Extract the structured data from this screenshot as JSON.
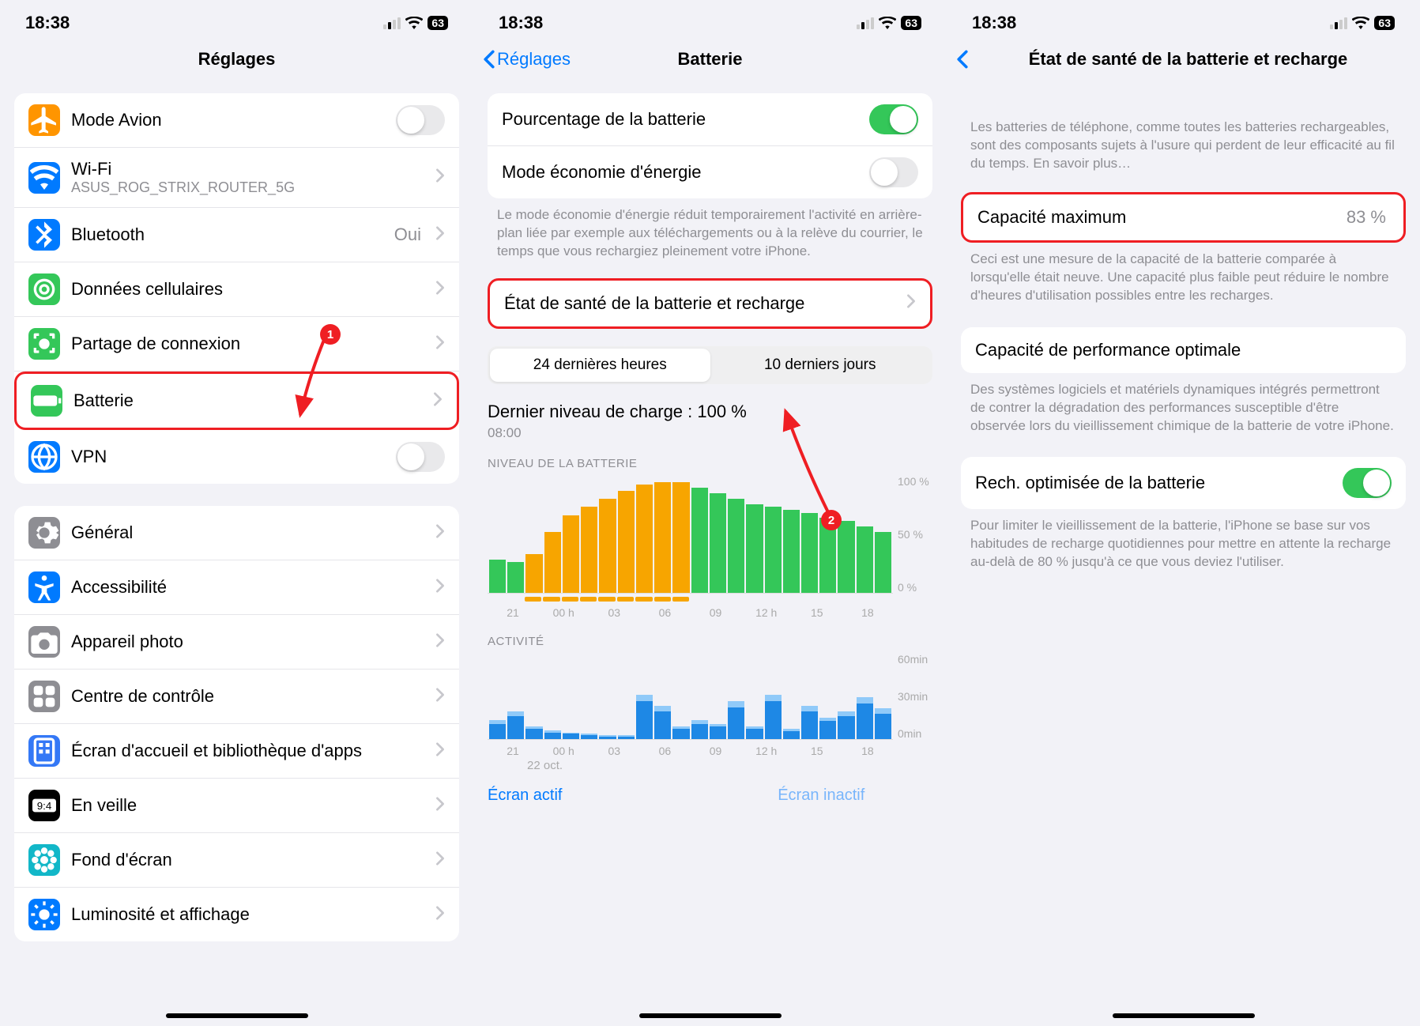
{
  "status": {
    "time": "18:38",
    "battery": "63"
  },
  "screen1": {
    "title": "Réglages",
    "group1": [
      {
        "icon": "airplane",
        "color": "#ff9500",
        "label": "Mode Avion",
        "right": "toggle-off"
      },
      {
        "icon": "wifi",
        "color": "#007aff",
        "label": "Wi-Fi",
        "sub": "ASUS_ROG_STRIX_ROUTER_5G",
        "right": "chevron"
      },
      {
        "icon": "bluetooth",
        "color": "#007aff",
        "label": "Bluetooth",
        "value": "Oui",
        "right": "chevron"
      },
      {
        "icon": "cellular",
        "color": "#34c759",
        "label": "Données cellulaires",
        "right": "chevron"
      },
      {
        "icon": "hotspot",
        "color": "#34c759",
        "label": "Partage de connexion",
        "right": "chevron"
      },
      {
        "icon": "battery",
        "color": "#34c759",
        "label": "Batterie",
        "right": "chevron",
        "highlight": true
      },
      {
        "icon": "vpn",
        "color": "#007aff",
        "label": "VPN",
        "right": "toggle-off"
      }
    ],
    "group2": [
      {
        "icon": "gear",
        "color": "#8e8e93",
        "label": "Général",
        "right": "chevron"
      },
      {
        "icon": "accessibility",
        "color": "#007aff",
        "label": "Accessibilité",
        "right": "chevron"
      },
      {
        "icon": "camera",
        "color": "#8e8e93",
        "label": "Appareil photo",
        "right": "chevron"
      },
      {
        "icon": "control",
        "color": "#8e8e93",
        "label": "Centre de contrôle",
        "right": "chevron"
      },
      {
        "icon": "home",
        "color": "#3478f6",
        "label": "Écran d'accueil et bibliothèque d'apps",
        "right": "chevron"
      },
      {
        "icon": "standby",
        "color": "#000",
        "label": "En veille",
        "right": "chevron"
      },
      {
        "icon": "wallpaper",
        "color": "#12b7c8",
        "label": "Fond d'écran",
        "right": "chevron"
      },
      {
        "icon": "brightness",
        "color": "#007aff",
        "label": "Luminosité et affichage",
        "right": "chevron"
      }
    ],
    "marker": "1"
  },
  "screen2": {
    "back": "Réglages",
    "title": "Batterie",
    "rows": [
      {
        "label": "Pourcentage de la batterie",
        "right": "toggle-on"
      },
      {
        "label": "Mode économie d'énergie",
        "right": "toggle-off"
      }
    ],
    "footer1": "Le mode économie d'énergie réduit temporairement l'activité en arrière-plan liée par exemple aux téléchargements ou à la relève du courrier, le temps que vous rechargiez pleinement votre iPhone.",
    "health_row": "État de santé de la batterie et recharge",
    "seg": {
      "a": "24 dernières heures",
      "b": "10 derniers jours"
    },
    "last_charge_label": "Dernier niveau de charge : 100 %",
    "last_charge_time": "08:00",
    "level_label": "NIVEAU DE LA BATTERIE",
    "level_y": [
      "100 %",
      "50 %",
      "0 %"
    ],
    "activity_label": "ACTIVITÉ",
    "activity_y": [
      "60min",
      "30min",
      "0min"
    ],
    "xaxis": [
      "21",
      "00 h",
      "03",
      "06",
      "09",
      "12 h",
      "15",
      "18"
    ],
    "date": "22 oct.",
    "tabs": {
      "a": "Écran actif",
      "b": "Écran inactif"
    },
    "marker": "2"
  },
  "screen3": {
    "title": "État de santé de la batterie et recharge",
    "intro": "Les batteries de téléphone, comme toutes les batteries rechargeables, sont des composants sujets à l'usure qui perdent de leur efficacité au fil du temps.",
    "intro_link": "En savoir plus…",
    "max_cap_label": "Capacité maximum",
    "max_cap_value": "83 %",
    "max_cap_footer": "Ceci est une mesure de la capacité de la batterie comparée à lorsqu'elle était neuve. Une capacité plus faible peut réduire le nombre d'heures d'utilisation possibles entre les recharges.",
    "perf_label": "Capacité de performance optimale",
    "perf_footer": "Des systèmes logiciels et matériels dynamiques intégrés permettront de contrer la dégradation des performances susceptible d'être observée lors du vieillissement chimique de la batterie de votre iPhone.",
    "opt_label": "Rech. optimisée de la batterie",
    "opt_footer": "Pour limiter le vieillissement de la batterie, l'iPhone se base sur vos habitudes de recharge quotidiennes pour mettre en attente la recharge au-delà de 80 % jusqu'à ce que vous deviez l'utiliser."
  },
  "chart_data": [
    {
      "type": "bar",
      "title": "NIVEAU DE LA BATTERIE",
      "ylabel": "%",
      "ylim": [
        0,
        100
      ],
      "categories": [
        "21",
        "22",
        "23",
        "00",
        "01",
        "02",
        "03",
        "04",
        "05",
        "06",
        "07",
        "08",
        "09",
        "10",
        "11",
        "12",
        "13",
        "14",
        "15",
        "16",
        "17",
        "18"
      ],
      "series": [
        {
          "name": "charging",
          "color": "#f7a500",
          "values": [
            0,
            0,
            35,
            55,
            70,
            78,
            85,
            92,
            98,
            100,
            100,
            0,
            0,
            0,
            0,
            0,
            0,
            0,
            0,
            0,
            0,
            0
          ]
        },
        {
          "name": "normal",
          "color": "#34c759",
          "values": [
            30,
            28,
            0,
            0,
            0,
            0,
            0,
            0,
            0,
            0,
            0,
            95,
            90,
            85,
            80,
            78,
            75,
            72,
            68,
            65,
            60,
            55
          ]
        }
      ]
    },
    {
      "type": "bar",
      "title": "ACTIVITÉ",
      "ylabel": "min",
      "ylim": [
        0,
        60
      ],
      "categories": [
        "21",
        "22",
        "23",
        "00",
        "01",
        "02",
        "03",
        "04",
        "05",
        "06",
        "07",
        "08",
        "09",
        "10",
        "11",
        "12",
        "13",
        "14",
        "15",
        "16",
        "17",
        "18"
      ],
      "series": [
        {
          "name": "active",
          "color": "#1e88e5",
          "values": [
            12,
            18,
            8,
            5,
            4,
            3,
            2,
            2,
            30,
            22,
            8,
            12,
            10,
            25,
            8,
            30,
            6,
            22,
            14,
            18,
            28,
            20
          ]
        },
        {
          "name": "idle",
          "color": "#90caf9",
          "values": [
            3,
            4,
            2,
            2,
            1,
            1,
            1,
            1,
            5,
            4,
            2,
            3,
            2,
            5,
            2,
            5,
            2,
            4,
            3,
            4,
            5,
            4
          ]
        }
      ]
    }
  ]
}
